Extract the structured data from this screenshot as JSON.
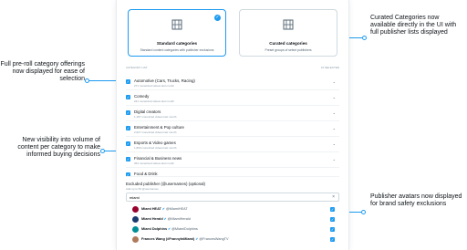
{
  "cards": [
    {
      "title": "Standard categories",
      "sub": "Standard content categories with publisher exclusions",
      "selected": true
    },
    {
      "title": "Curated categories",
      "sub": "Preset groups of select publishers",
      "selected": false
    }
  ],
  "list_head": {
    "left": "CATEGORY LIST",
    "right": "10 SELECTED"
  },
  "categories": [
    {
      "name": "Automotive (Cars, Trucks, Racing)",
      "meta": "271 monetized videos last month"
    },
    {
      "name": "Comedy",
      "meta": "241 monetized videos last month"
    },
    {
      "name": "Digital creators",
      "meta": "1,187 monetized videos last month"
    },
    {
      "name": "Entertainment & Pop culture",
      "meta": "2,627 monetized videos last month"
    },
    {
      "name": "Esports & Video games",
      "meta": "1,869 monetized videos last month"
    },
    {
      "name": "Financial & Business news",
      "meta": "364 monetized videos last month"
    },
    {
      "name": "Food & Drink",
      "meta": ""
    }
  ],
  "exclusion": {
    "label": "Excluded publisher (@usernames) (optional)",
    "sub": "Add up to 50 @usernames",
    "search_value": "miami"
  },
  "publishers": [
    {
      "name": "Miami HEAT",
      "handle": "@MiamiHEAT",
      "avatar_color": "#98002e"
    },
    {
      "name": "Miami Herald",
      "handle": "@MiamiHerald",
      "avatar_color": "#1a3b6e"
    },
    {
      "name": "Miami Dolphins",
      "handle": "@MiamiDolphins",
      "avatar_color": "#008e97"
    },
    {
      "name": "Frances Wang (#FrannyInMiami)",
      "handle": "@FrancesWangTV",
      "avatar_color": "#b07a5a"
    }
  ],
  "callouts": {
    "curated": "Curated Categories now available directly in the UI with full publisher lists displayed",
    "preroll": "Full pre-roll category offerings now displayed for ease of selection",
    "visibility": "New visibility into volume of content per category to make informed buying decisions",
    "avatars": "Publisher avatars now displayed for brand safety exclusions"
  },
  "accent_color": "#1d9bf0",
  "icons": {
    "check": "✓",
    "chevron": "⌄",
    "clear": "×",
    "verified": "✔"
  }
}
